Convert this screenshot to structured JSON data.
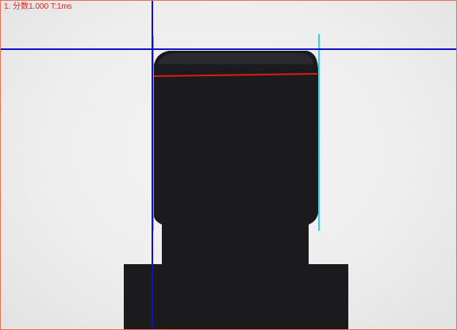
{
  "status_overlay": {
    "text": "1. 分数1.000  T:1ms"
  },
  "colors": {
    "part": "#1b1b1d",
    "reference_line": "#1010c8",
    "edge_line": "#27d6e8",
    "measure_line": "#e01818",
    "overlay_text": "#e02020",
    "frame_border": "#e87050"
  }
}
